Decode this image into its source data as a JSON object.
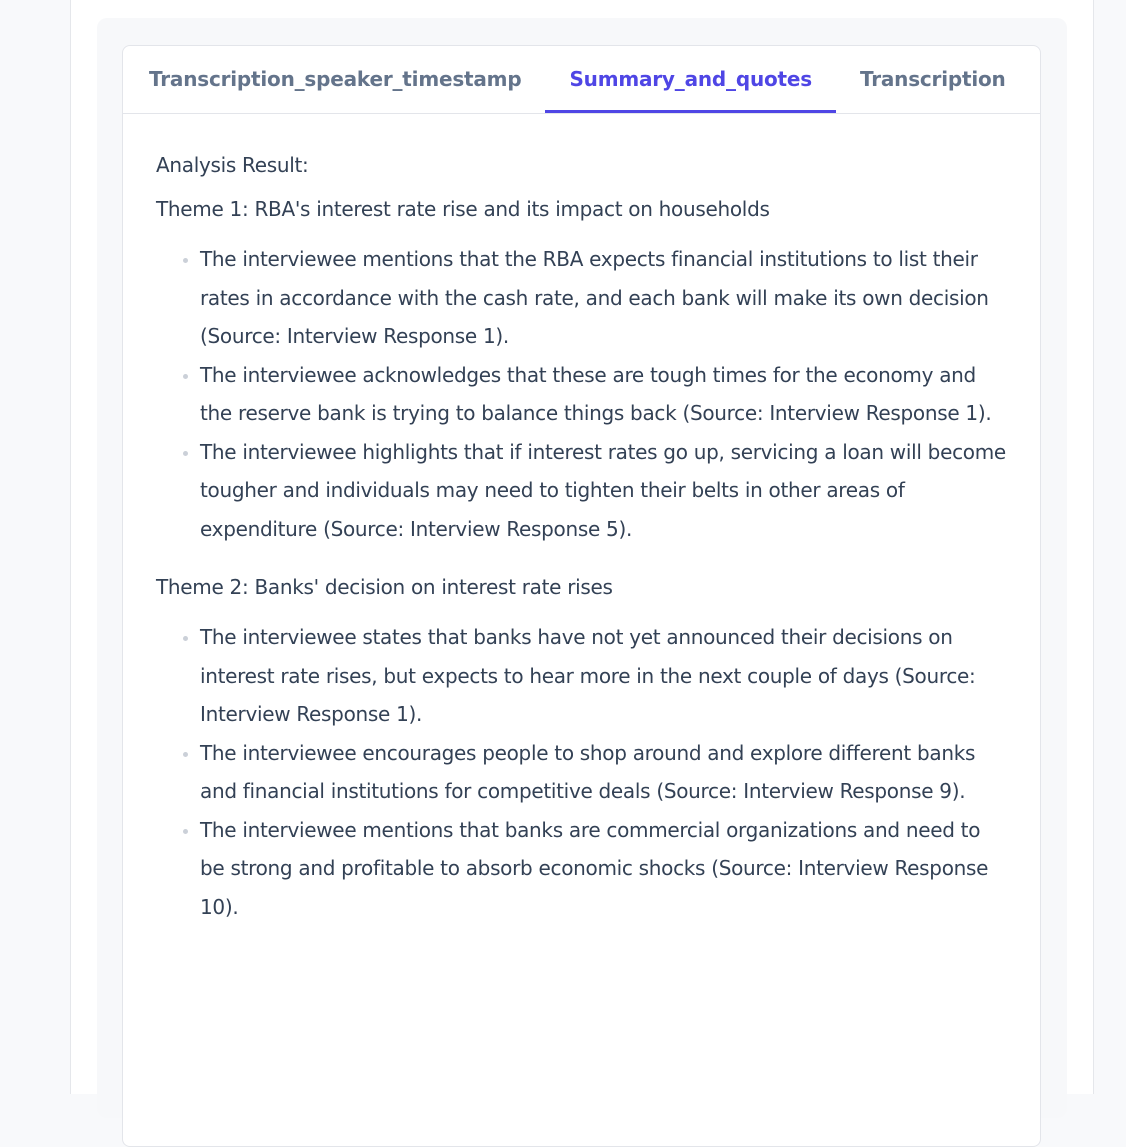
{
  "tabs": [
    {
      "label": "Transcription_speaker_timestamp",
      "active": false
    },
    {
      "label": "Summary_and_quotes",
      "active": true
    },
    {
      "label": "Transcription",
      "active": false
    }
  ],
  "content": {
    "heading": "Analysis Result:",
    "themes": [
      {
        "title": "Theme 1: RBA's interest rate rise and its impact on households",
        "bullets": [
          "The interviewee mentions that the RBA expects financial institutions to list their rates in accordance with the cash rate, and each bank will make its own decision (Source: Interview Response 1).",
          "The interviewee acknowledges that these are tough times for the economy and the reserve bank is trying to balance things back (Source: Interview Response 1).",
          "The interviewee highlights that if interest rates go up, servicing a loan will become tougher and individuals may need to tighten their belts in other areas of expenditure (Source: Interview Response 5)."
        ]
      },
      {
        "title": "Theme 2: Banks' decision on interest rate rises",
        "bullets": [
          "The interviewee states that banks have not yet announced their decisions on interest rate rises, but expects to hear more in the next couple of days (Source: Interview Response 1).",
          "The interviewee encourages people to shop around and explore different banks and financial institutions for competitive deals (Source: Interview Response 9).",
          "The interviewee mentions that banks are commercial organizations and need to be strong and profitable to absorb economic shocks (Source: Interview Response 10)."
        ]
      }
    ]
  }
}
